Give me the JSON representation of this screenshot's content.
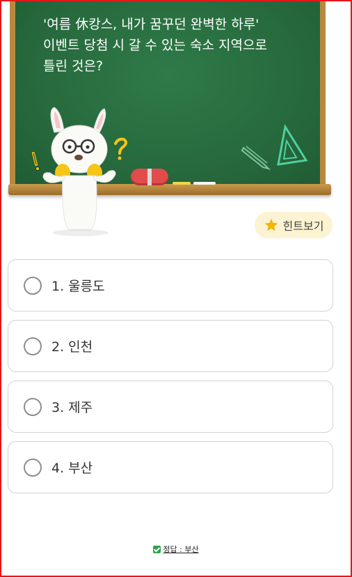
{
  "question": {
    "line1": "'여름 休캉스, 내가 꿈꾸던 완벽한 하루'",
    "line2": "이벤트 당첨 시 갈 수 있는 숙소 지역으로",
    "line3": "틀린 것은?"
  },
  "hint": {
    "label": "힌트보기",
    "icon": "star-icon"
  },
  "options": [
    {
      "label": "1. 울릉도"
    },
    {
      "label": "2. 인천"
    },
    {
      "label": "3. 제주"
    },
    {
      "label": "4. 부산"
    }
  ],
  "answer": {
    "label": "정답 : 부산",
    "icon": "check-icon"
  },
  "colors": {
    "board": "#276a3d",
    "frame": "#b7893f",
    "border_highlight": "#e5161b",
    "hint_bg": "#fbf3d2"
  }
}
